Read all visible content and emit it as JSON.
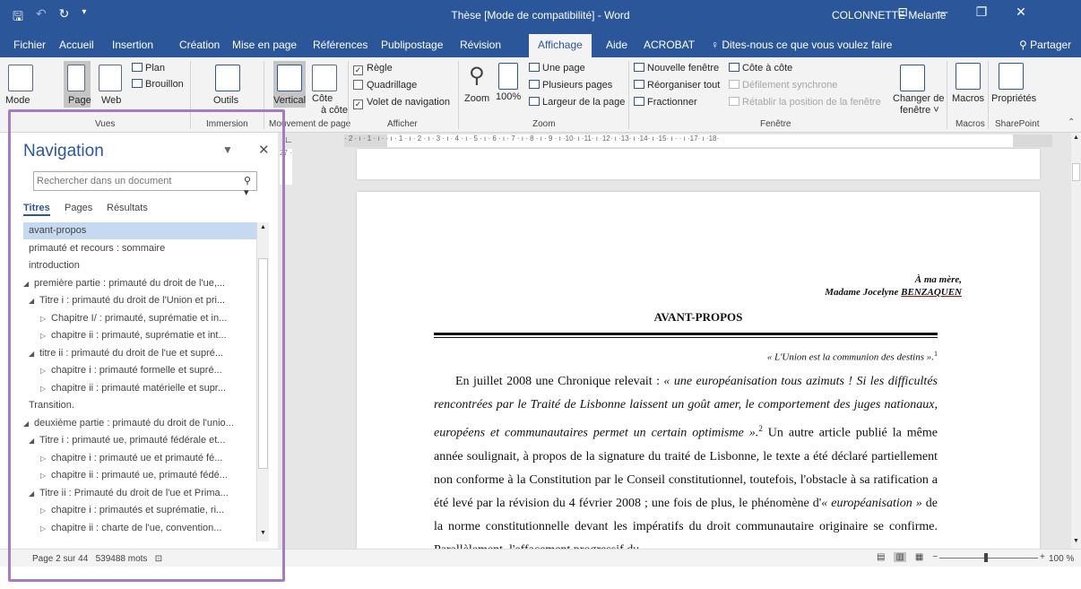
{
  "window": {
    "title": "Thèse [Mode de compatibilité]  -  Word",
    "user": "COLONNETTE Melanie",
    "qat_icons": [
      "save-icon",
      "undo-icon",
      "redo-icon",
      "customize-icon"
    ],
    "controls": [
      "ribbon-display-icon",
      "minimize-icon",
      "maximize-icon",
      "close-icon"
    ]
  },
  "tabs": [
    "Fichier",
    "Accueil",
    "Insertion",
    "Création",
    "Mise en page",
    "Références",
    "Publipostage",
    "Révision",
    "Affichage",
    "Aide",
    "ACROBAT"
  ],
  "active_tab": "Affichage",
  "tell_me": "Dites-nous ce que vous voulez faire",
  "share": "Partager",
  "ribbon": {
    "vues": {
      "label": "Vues",
      "mode_lecture": "Mode",
      "page": "Page",
      "web": "Web",
      "plan": "Plan",
      "brouillon": "Brouillon"
    },
    "immersion": {
      "label": "Immersion",
      "outils": "Outils"
    },
    "mouvement": {
      "label": "Mouvement de page",
      "vertical": "Vertical",
      "cote_a_cote": "Côte",
      "cote_a_cote2": "à côte"
    },
    "afficher": {
      "label": "Afficher",
      "regle": "Règle",
      "quadrillage": "Quadrillage",
      "volet": "Volet de navigation",
      "regle_checked": "✓",
      "volet_checked": "✓"
    },
    "zoom": {
      "label": "Zoom",
      "zoom": "Zoom",
      "pct100": "100%",
      "une_page": "Une page",
      "plusieurs_pages": "Plusieurs pages",
      "largeur": "Largeur de la page"
    },
    "fenetre": {
      "label": "Fenêtre",
      "nouvelle": "Nouvelle fenêtre",
      "reorganiser": "Réorganiser tout",
      "fractionner": "Fractionner",
      "cote": "Côte à côte",
      "defilement": "Défilement synchrone",
      "retablir": "Rétablir la position de la fenêtre",
      "changer1": "Changer de",
      "changer2": "fenêtre ˅"
    },
    "macros": {
      "label": "Macros",
      "btn": "Macros"
    },
    "sharepoint": {
      "label": "SharePoint",
      "btn": "Propriétés"
    }
  },
  "navigation": {
    "title": "Navigation",
    "search_placeholder": "Rechercher dans un document",
    "tabs": [
      "Titres",
      "Pages",
      "Résultats"
    ],
    "items": [
      {
        "text": "avant-propos",
        "level": 0,
        "arrow": "",
        "selected": true
      },
      {
        "text": "primauté et recours : sommaire",
        "level": 0,
        "arrow": ""
      },
      {
        "text": "introduction",
        "level": 0,
        "arrow": ""
      },
      {
        "text": "première partie : primauté du droit de l'ue,...",
        "level": 0,
        "arrow": "◢"
      },
      {
        "text": "Titre i : primauté du droit de l'Union et pri...",
        "level": 1,
        "arrow": "◢"
      },
      {
        "text": "Chapitre I/ : primauté, suprématie et in...",
        "level": 2,
        "arrow": "▷"
      },
      {
        "text": "chapitre ii : primauté, suprématie et int...",
        "level": 2,
        "arrow": "▷"
      },
      {
        "text": "titre ii : primauté du droit de l'ue et supré...",
        "level": 1,
        "arrow": "◢"
      },
      {
        "text": "chapitre i : primauté formelle et supré...",
        "level": 2,
        "arrow": "▷"
      },
      {
        "text": "chapitre ii : primauté matérielle et supr...",
        "level": 2,
        "arrow": "▷"
      },
      {
        "text": "Transition.",
        "level": 0,
        "arrow": ""
      },
      {
        "text": "deuxième partie : primauté du droit de l'unio...",
        "level": 0,
        "arrow": "◢"
      },
      {
        "text": "Titre i : primauté ue, primauté fédérale et...",
        "level": 1,
        "arrow": "◢"
      },
      {
        "text": "chapitre i : primauté ue et primauté fé...",
        "level": 2,
        "arrow": "▷"
      },
      {
        "text": "chapitre ii : primauté ue, primauté fédé...",
        "level": 2,
        "arrow": "▷"
      },
      {
        "text": "Titre ii : Primauté du droit de l'ue et Prima...",
        "level": 1,
        "arrow": "◢"
      },
      {
        "text": "chapitre i : primautés et suprématie, ri...",
        "level": 2,
        "arrow": "▷"
      },
      {
        "text": "chapitre ii : charte de l'ue, convention...",
        "level": 2,
        "arrow": "▷"
      }
    ]
  },
  "ruler": "· 2 · ı · 1 · ı ·   · ı · 1 · ı · 2 · ı · 3 · ı · 4 · ı · 5 · ı · 6 · ı · 7 · ı · 8 · ı · 9 · ı ·10· ı ·11· ı ·12· ı ·13· ı ·14· ı ·15· ı ·   · ı ·17· ı ·18·",
  "vruler": "27 ·",
  "document": {
    "dedication1": "À ma mère,",
    "dedication2": "Madame Jocelyne ",
    "dedication_name": "BENZAQUEN",
    "title": "AVANT-PROPOS",
    "epigraph": "« L'Union est la communion des destins ».",
    "epigraph_note": "1",
    "p_start": "En juillet 2008 une Chronique relevait : ",
    "p_quote": "« une européanisation tous azimuts ! Si les difficultés rencontrées par le Traité de Lisbonne laissent un goût amer, le comportement des juges nationaux, européens et communautaires permet un certain optimisme ».",
    "p_note": "2",
    "p_rest": " Un autre article publié la même année soulignait, à propos de la signature du traité de Lisbonne, le texte a été déclaré partiellement non conforme à la Constitution par le Conseil constitutionnel, toutefois, l'obstacle à sa ratification a été levé par la révision du 4 février 2008 ; une fois de plus, le phénomène d'",
    "p_term": "« européanisation »",
    "p_end": " de la norme constitutionnelle devant les impératifs du droit communautaire originaire se confirme. Parallèlement, l'effacement progressif du"
  },
  "status": {
    "page": "Page 2 sur 44",
    "words": "539488 mots",
    "zoom": "100 %",
    "zoom_level_percent": 100
  },
  "colors": {
    "accent": "#2b579a",
    "highlight_frame": "#a57bc6"
  }
}
